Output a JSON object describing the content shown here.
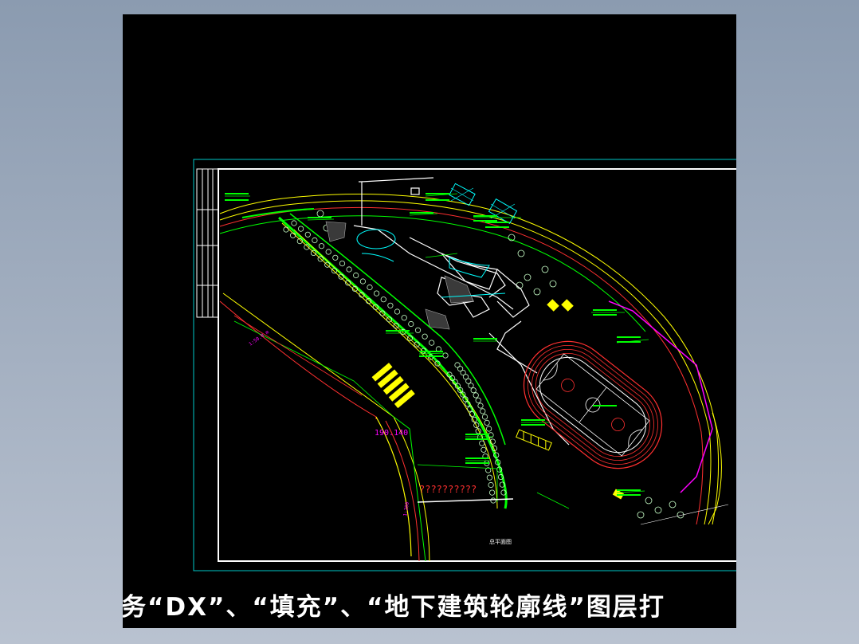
{
  "viewer": {
    "background_color": "#000000",
    "frame_color": "#00c8c8",
    "caption": "务“DX”、“填充”、“地下建筑轮廓线”图层打"
  },
  "drawing": {
    "title_label": "总平面图",
    "chainage_label": "190.140",
    "placeholder_note": "??????????",
    "side_label_1": "1:50.0 m",
    "side_label_2": "1:200"
  },
  "colors": {
    "road_line": "#00ff00",
    "contour": "#ffff00",
    "boundary": "#ff3030",
    "building": "#ffffff",
    "water": "#00ffff",
    "track": "#ff3030",
    "highlight": "#ff00ff",
    "hatch": "#ffff00"
  },
  "icons": [
    "tree-symbol-icon",
    "crosswalk-hatch-icon",
    "water-pond-icon"
  ]
}
